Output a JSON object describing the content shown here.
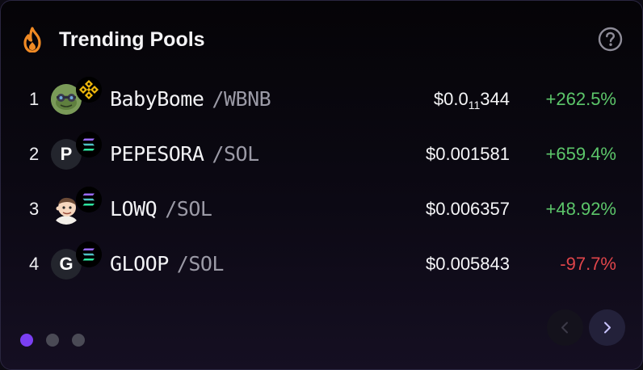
{
  "header": {
    "title": "Trending Pools",
    "title_icon": "fire-icon",
    "help_icon": "question-circle-icon"
  },
  "pools": [
    {
      "rank": "1",
      "avatar": "frog-token-logo",
      "chain_icon": "bnb-chain-icon",
      "base": "BabyBome",
      "quote": "/WBNB",
      "price_prefix": "$0.0",
      "price_subscript": "11",
      "price_digits": "344",
      "change": "+262.5%",
      "direction": "up"
    },
    {
      "rank": "2",
      "avatar_letter": "P",
      "chain_icon": "solana-chain-icon",
      "base": "PEPESORA",
      "quote": "/SOL",
      "price": "$0.001581",
      "change": "+659.4%",
      "direction": "up"
    },
    {
      "rank": "3",
      "avatar": "cartoon-character-token-logo",
      "chain_icon": "solana-chain-icon",
      "base": "LOWQ",
      "quote": "/SOL",
      "price": "$0.006357",
      "change": "+48.92%",
      "direction": "up"
    },
    {
      "rank": "4",
      "avatar_letter": "G",
      "chain_icon": "solana-chain-icon",
      "base": "GLOOP",
      "quote": "/SOL",
      "price": "$0.005843",
      "change": "-97.7%",
      "direction": "down"
    }
  ],
  "pagination": {
    "page_count": 3,
    "active_page": 1,
    "prev_icon": "chevron-left-icon",
    "next_icon": "chevron-right-icon"
  },
  "colors": {
    "positive": "#5cc66a",
    "negative": "#e0454a",
    "accent": "#7b3ff2",
    "fire": "#f08a24",
    "bnb": "#f0b90b"
  }
}
